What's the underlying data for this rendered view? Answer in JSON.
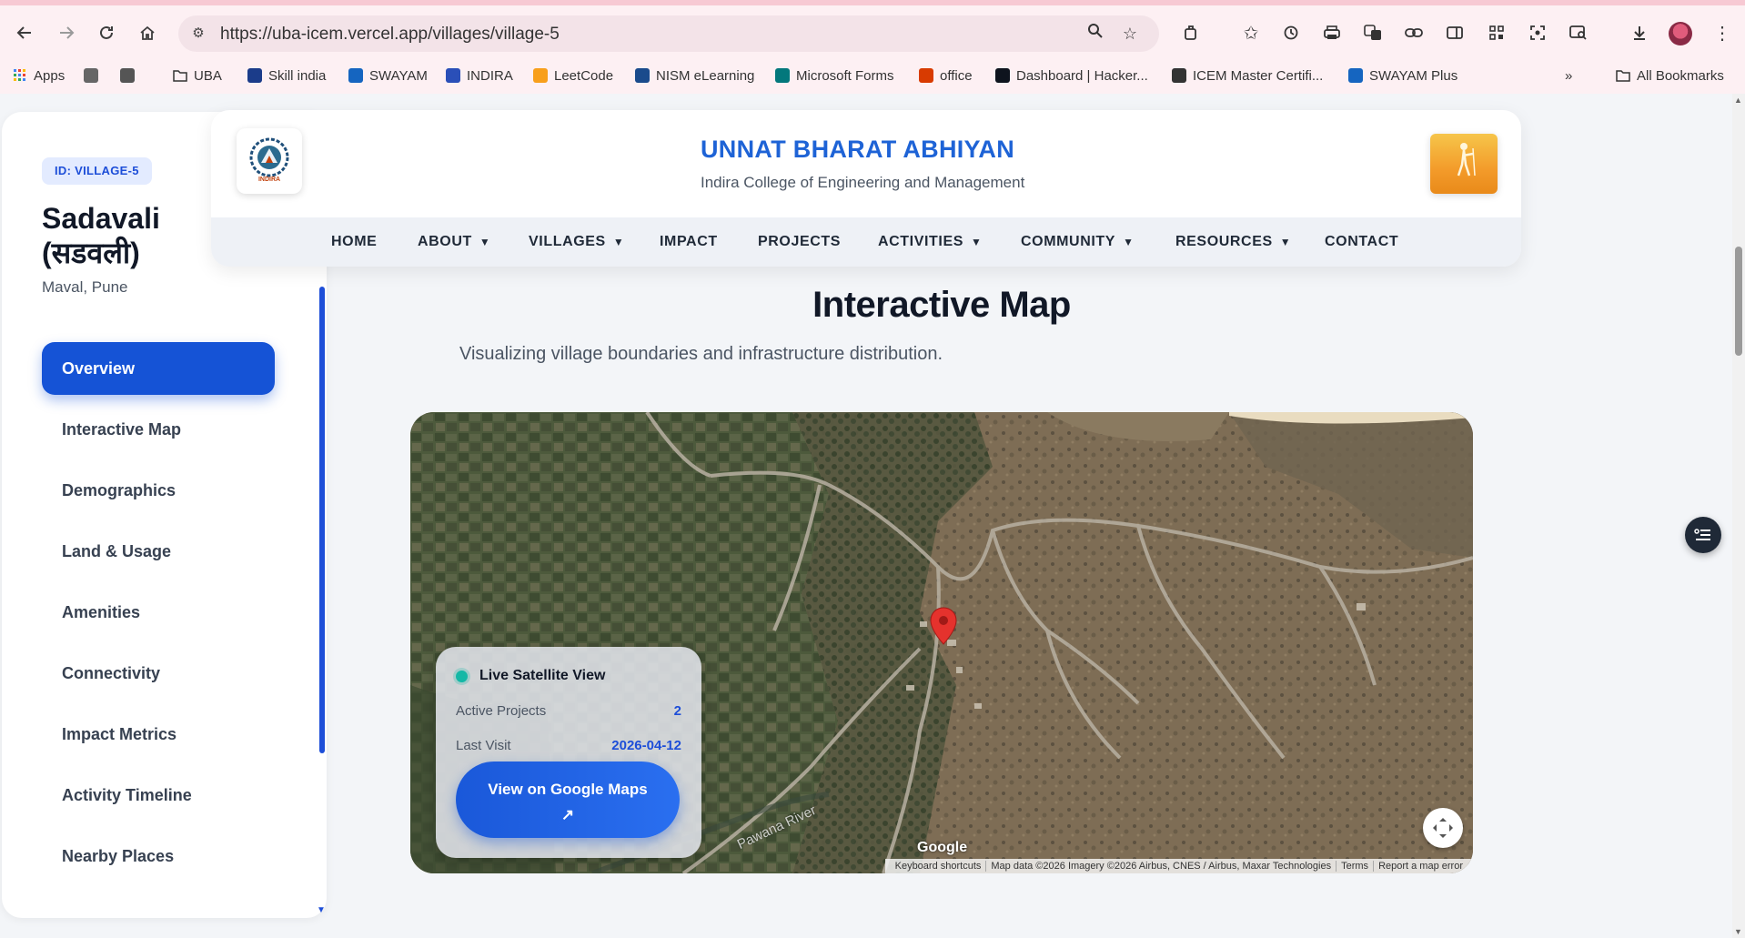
{
  "browser": {
    "url": "https://uba-icem.vercel.app/villages/village-5",
    "bookmarks": [
      {
        "label": "Apps",
        "icon": "apps-grid-icon"
      },
      {
        "label": "",
        "icon": "extension-square-icon"
      },
      {
        "label": "",
        "icon": "tab-groups-icon"
      },
      {
        "label": "UBA",
        "icon": "folder-icon"
      },
      {
        "label": "Skill india",
        "icon": "skill-india-icon"
      },
      {
        "label": "SWAYAM",
        "icon": "swayam-icon"
      },
      {
        "label": "INDIRA",
        "icon": "indira-icon"
      },
      {
        "label": "LeetCode",
        "icon": "leetcode-icon"
      },
      {
        "label": "NISM eLearning",
        "icon": "nism-icon"
      },
      {
        "label": "Microsoft Forms",
        "icon": "ms-forms-icon"
      },
      {
        "label": "office",
        "icon": "office-icon"
      },
      {
        "label": "Dashboard | Hacker...",
        "icon": "hackerrank-icon"
      },
      {
        "label": "ICEM Master Certifi...",
        "icon": "globe-icon"
      },
      {
        "label": "SWAYAM Plus",
        "icon": "swayam-icon"
      }
    ],
    "all_bookmarks": "All Bookmarks",
    "more_bookmarks": "»"
  },
  "sidebar": {
    "id_badge": "ID: VILLAGE-5",
    "village_name": "Sadavali (सडवली)",
    "location": "Maval, Pune",
    "items": [
      {
        "label": "Overview",
        "active": true
      },
      {
        "label": "Interactive Map",
        "active": false
      },
      {
        "label": "Demographics",
        "active": false
      },
      {
        "label": "Land & Usage",
        "active": false
      },
      {
        "label": "Amenities",
        "active": false
      },
      {
        "label": "Connectivity",
        "active": false
      },
      {
        "label": "Impact Metrics",
        "active": false
      },
      {
        "label": "Activity Timeline",
        "active": false
      },
      {
        "label": "Nearby Places",
        "active": false
      }
    ]
  },
  "header": {
    "title": "UNNAT BHARAT ABHIYAN",
    "subtitle": "Indira College of Engineering and Management",
    "left_logo_text": "INDIRA",
    "nav": [
      {
        "label": "HOME",
        "dropdown": false
      },
      {
        "label": "ABOUT",
        "dropdown": true
      },
      {
        "label": "VILLAGES",
        "dropdown": true
      },
      {
        "label": "IMPACT",
        "dropdown": false
      },
      {
        "label": "PROJECTS",
        "dropdown": false
      },
      {
        "label": "ACTIVITIES",
        "dropdown": true
      },
      {
        "label": "COMMUNITY",
        "dropdown": true
      },
      {
        "label": "RESOURCES",
        "dropdown": true
      },
      {
        "label": "CONTACT",
        "dropdown": false
      }
    ],
    "dropdown_glyph": "▼"
  },
  "section": {
    "title": "Interactive Map",
    "subtitle": "Visualizing village boundaries and infrastructure distribution."
  },
  "map": {
    "overlay_title": "Live Satellite View",
    "active_projects_label": "Active Projects",
    "active_projects_value": "2",
    "last_visit_label": "Last Visit",
    "last_visit_value": "2026-04-12",
    "button_label": "View on Google Maps",
    "button_icon": "↗",
    "river_label": "Pawana River",
    "google": "Google",
    "attribution": [
      "Keyboard shortcuts",
      "Map data ©2026 Imagery ©2026 Airbus, CNES / Airbus, Maxar Technologies",
      "Terms",
      "Report a map error"
    ]
  },
  "colors": {
    "accent": "#1553d6",
    "title_blue": "#1e63d6",
    "live_dot": "#14b8a6"
  }
}
